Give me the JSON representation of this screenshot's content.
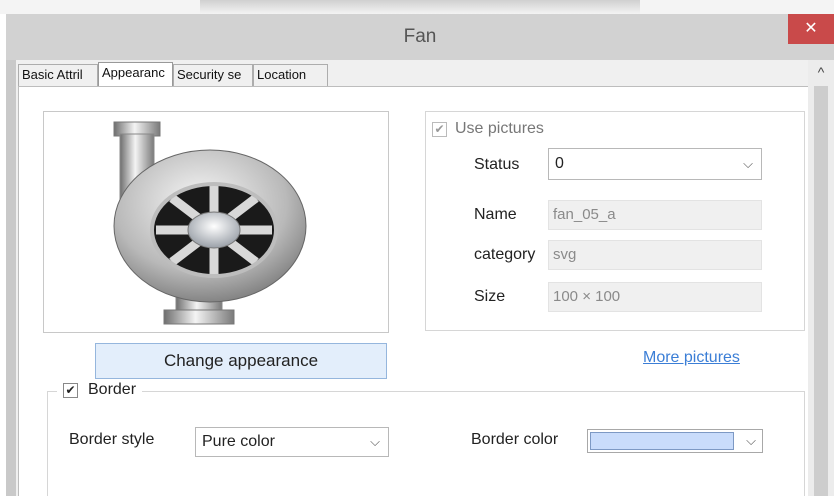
{
  "dialog": {
    "title": "Fan",
    "close_glyph": "✕"
  },
  "tabs": [
    {
      "label": "Basic Attril"
    },
    {
      "label": "Appearanc"
    },
    {
      "label": "Security se"
    },
    {
      "label": "Location"
    }
  ],
  "scroll": {
    "up_glyph": "^"
  },
  "preview": {
    "button_label": "Change appearance"
  },
  "pictures": {
    "use_pictures_label": "Use pictures",
    "status_label": "Status",
    "status_value": "0",
    "name_label": "Name",
    "name_value": "fan_05_a",
    "category_label": "category",
    "category_value": "svg",
    "size_label": "Size",
    "size_value": "100 × 100",
    "more_link": "More pictures"
  },
  "border": {
    "legend": "Border",
    "style_label": "Border style",
    "style_value": "Pure color",
    "color_label": "Border color",
    "color_value": "#c9dcfb"
  },
  "glyphs": {
    "check": "✔",
    "dropdown": "⌵"
  }
}
